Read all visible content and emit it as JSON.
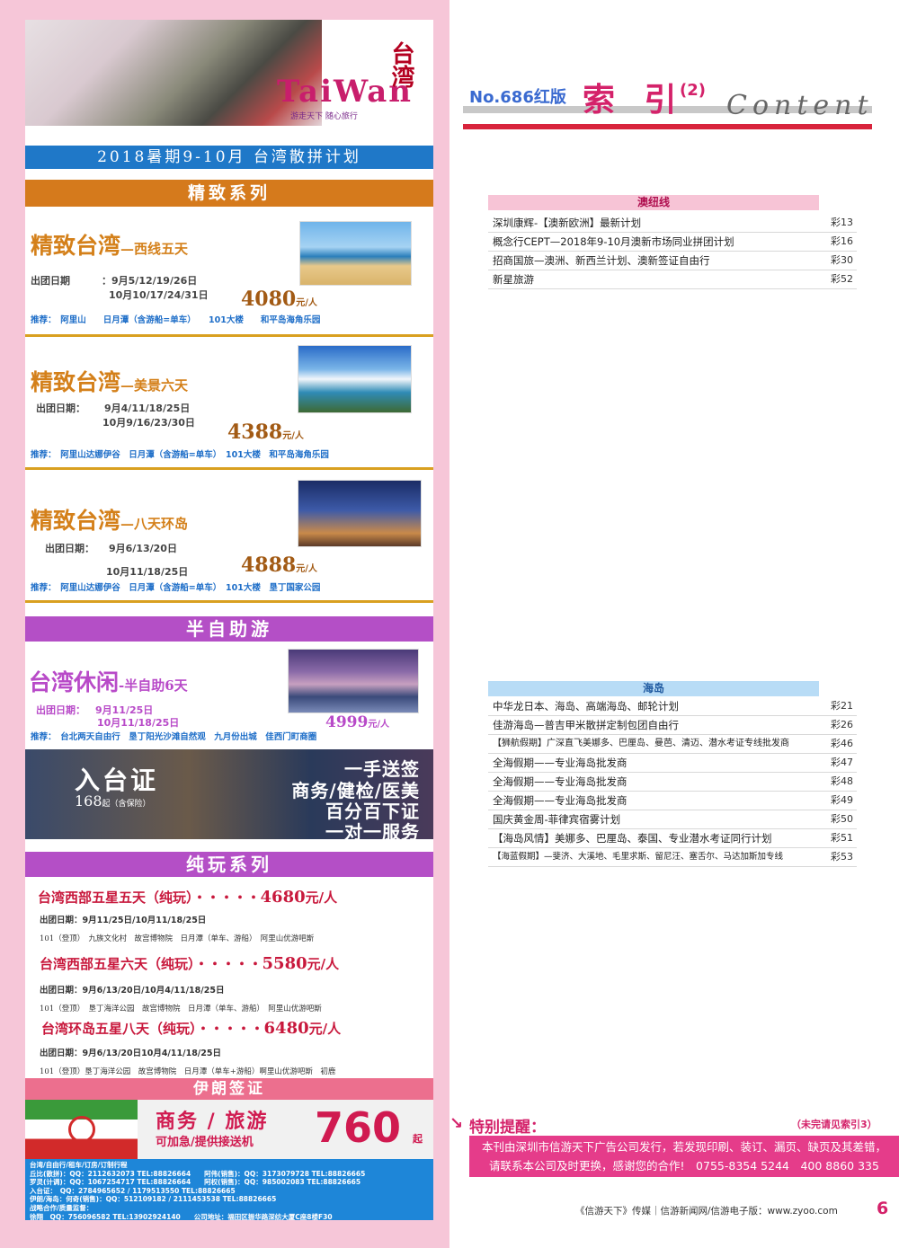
{
  "left": {
    "logo": {
      "latin": "TaiWan",
      "chinese": "台湾",
      "slogan": "游走天下 随心旅行"
    },
    "plan_title": "2018暑期9-10月 台湾散拼计划",
    "sections": {
      "jingzhi": "精致系列",
      "banzizhu": "半自助游",
      "chunwan": "纯玩系列",
      "iran": "伊朗签证"
    },
    "products": [
      {
        "title": "精致台湾",
        "subtitle": "—西线五天",
        "date_label": "出团日期",
        "dates1": "：9月5/12/19/26日",
        "dates2": "10月10/17/24/31日",
        "price": "4080",
        "price_unit": "元/人",
        "rec_label": "推荐：",
        "rec": "阿里山　　日月潭（含游船=单车）　　101大楼　　和平岛海角乐园"
      },
      {
        "title": "精致台湾",
        "subtitle": "—美景六天",
        "date_label": "出团日期：",
        "dates1": "9月4/11/18/25日",
        "dates2": "10月9/16/23/30日",
        "price": "4388",
        "price_unit": "元/人",
        "rec_label": "推荐：",
        "rec": "阿里山达娜伊谷　日月潭（含游船=单车）　101大楼　和平岛海角乐园"
      },
      {
        "title": "精致台湾",
        "subtitle": "—八天环岛",
        "date_label": "出团日期：",
        "dates1": "9月6/13/20日",
        "dates2": "10月11/18/25日",
        "price": "4888",
        "price_unit": "元/人",
        "rec_label": "推荐：",
        "rec": "阿里山达娜伊谷　日月潭（含游船=单车）　101大楼　垦丁国家公园"
      }
    ],
    "semi": {
      "title": "台湾休闲",
      "subtitle": "-半自助6天",
      "date_label": "出团日期：",
      "dates1": "9月11/25日",
      "dates2": "10月11/18/25日",
      "price": "4999",
      "price_unit": "元/人",
      "rec_label": "推荐：",
      "rec": "台北两天自由行　垦丁阳光沙滩自然观　九月份出城　佳西门町商圈"
    },
    "entry": {
      "title": "入台证",
      "price": "168",
      "price_note": "起（含保险）",
      "lines": [
        "一手送签",
        "商务/健检/医美",
        "百分百下证",
        "一对一服务"
      ]
    },
    "pure": [
      {
        "title": "台湾西部五星五天（纯玩）・・・・・",
        "price": "4680",
        "unit": "元/人",
        "dates": "出团日期：9月11/25日/10月11/18/25日",
        "sites": "101（登顶）　九族文化村　故宫博物院　日月潭（单车、游船）　阿里山优游吧斯"
      },
      {
        "title": "台湾西部五星六天（纯玩）・・・・・",
        "price": "5580",
        "unit": "元/人",
        "dates": "出团日期：9月6/13/20日/10月4/11/18/25日",
        "sites": "101（登顶）　垦丁海洋公园　故宫博物院　日月潭（单车、游船）　阿里山优游吧斯"
      },
      {
        "title": "台湾环岛五星八天（纯玩）・・・・・",
        "price": "6480",
        "unit": "元/人",
        "dates": "出团日期：9月6/13/20日10月4/11/18/25日",
        "sites": "101（登顶）垦丁海洋公园　故宫博物院　日月潭（单车+游船）啊里山优游吧斯　初鹿"
      }
    ],
    "iran": {
      "business": "商务 / 旅游",
      "extra": "可加急/提供接送机",
      "price": "760",
      "unit": "起"
    },
    "contact": [
      "台湾/自由行/租车/订房/订制行程",
      "丘比(散拼)：QQ：2112632073  TEL:88826664　　阿伟(销售)：QQ：3173079728  TEL:88826665",
      "罗灵(计调)：QQ：1067254717  TEL:88826664　　阿权(销售)：QQ：985002083  TEL:88826665",
      "入台证：　QQ：2784965652 / 1179513550  TEL:88826665",
      "伊朗/海岛：何奇(销售)：QQ：512109182 / 2111453538  TEL:88826665",
      "战略合作/质量监督：",
      "徐翔　QQ：756096582  TEL:13902924140　　公司地址：福田区振华路深纺大厦C座8楼F30"
    ]
  },
  "right": {
    "header": {
      "issue": "No.686红版",
      "title": "索 引",
      "num": "(2)",
      "script": "Content"
    },
    "aus": {
      "head": "澳纽线",
      "rows": [
        {
          "t": "深圳康辉-【澳新欧洲】最新计划",
          "p": "彩13"
        },
        {
          "t": "概念行CEPT—2018年9-10月澳新市场同业拼团计划",
          "p": "彩16"
        },
        {
          "t": "招商国旅—澳洲、新西兰计划、澳新签证自由行",
          "p": "彩30"
        },
        {
          "t": "新星旅游",
          "p": "彩52"
        }
      ]
    },
    "island": {
      "head": "海岛",
      "rows": [
        {
          "t": "中华龙日本、海岛、高端海岛、邮轮计划",
          "p": "彩21"
        },
        {
          "t": "佳游海岛—普吉甲米散拼定制包团自由行",
          "p": "彩26"
        },
        {
          "t": "【狮航假期】广深直飞美娜多、巴厘岛、曼芭、清迈、潜水考证专线批发商",
          "p": "彩46"
        },
        {
          "t": "全海假期——专业海岛批发商",
          "p": "彩47"
        },
        {
          "t": "全海假期——专业海岛批发商",
          "p": "彩48"
        },
        {
          "t": "全海假期——专业海岛批发商",
          "p": "彩49"
        },
        {
          "t": "国庆黄金周-菲律宾宿雾计划",
          "p": "彩50"
        },
        {
          "t": "【海岛风情】美娜多、巴厘岛、泰国、专业潜水考证同行计划",
          "p": "彩51"
        },
        {
          "t": "【海蓝假期】—斐济、大溪地、毛里求斯、留尼汪、塞舌尔、马达加斯加专线",
          "p": "彩53"
        }
      ]
    },
    "reminder": {
      "arrow": "↘",
      "title": "特别提醒：",
      "note": "（未完请见索引3）",
      "text": "本刊由深圳市信游天下广告公司发行，若发现印刷、装订、漏页、缺页及其差错，请联系本公司及时更换，感谢您的合作!　0755-8354 5244　400 8860 335"
    },
    "footer": "《信游天下》传媒｜信游新闻网/信游电子版：www.zyoo.com",
    "page": "6"
  }
}
